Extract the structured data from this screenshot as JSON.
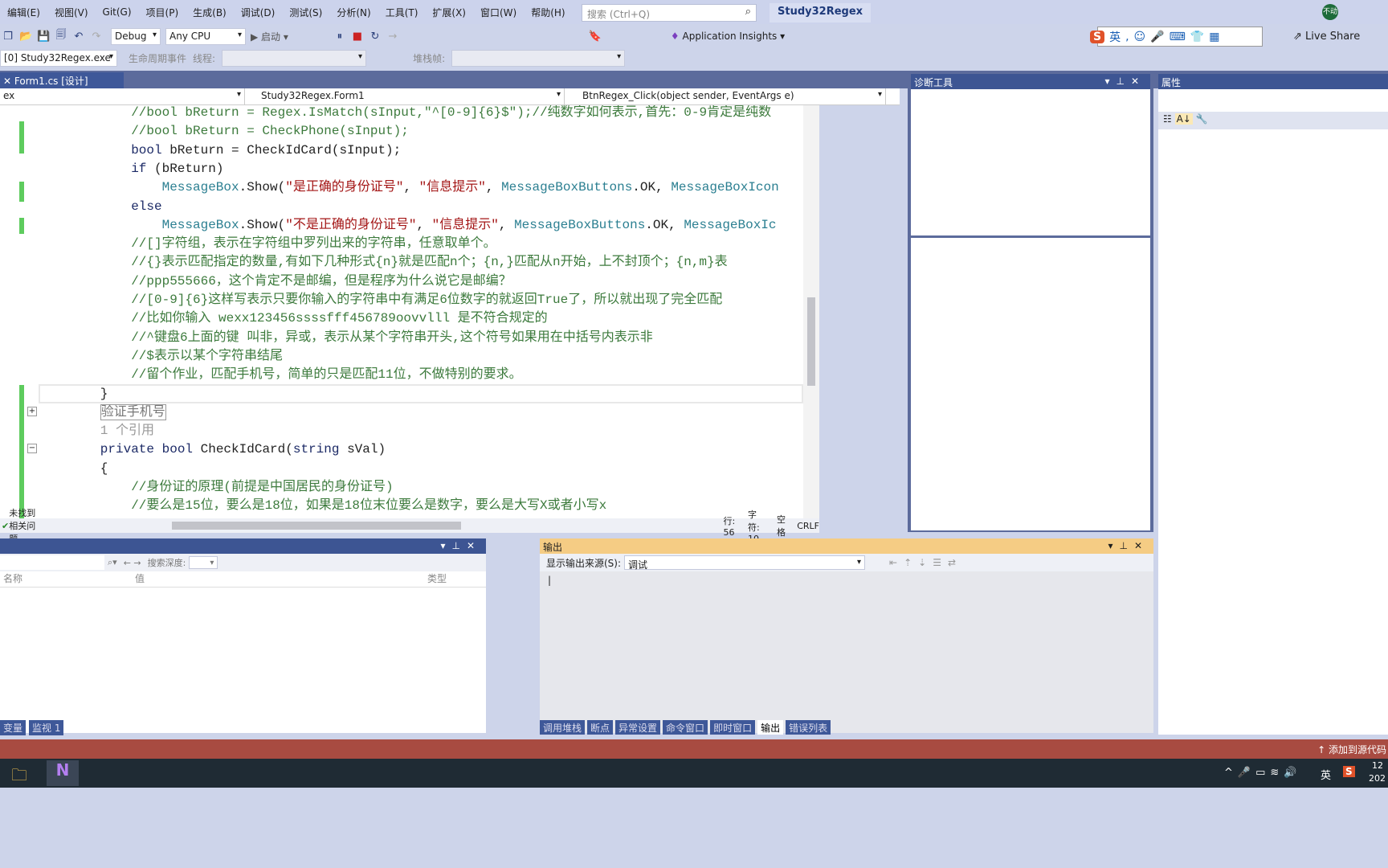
{
  "menu": [
    "编辑(E)",
    "视图(V)",
    "Git(G)",
    "项目(P)",
    "生成(B)",
    "调试(D)",
    "测试(S)",
    "分析(N)",
    "工具(T)",
    "扩展(X)",
    "窗口(W)",
    "帮助(H)"
  ],
  "search": {
    "placeholder": "搜索 (Ctrl+Q)"
  },
  "solution_name": "Study32Regex",
  "avatar_text": "不动",
  "toolbar": {
    "config": "Debug",
    "platform": "Any CPU",
    "start": "启动",
    "app_insights": "Application Insights",
    "live_share": "Live Share"
  },
  "ime": {
    "lang": "英"
  },
  "debug_bar": {
    "process": "[0] Study32Regex.exe",
    "lifecycle": "生命周期事件",
    "thread": "线程:",
    "stack": "堆栈帧:"
  },
  "editor_tab": "Form1.cs [设计]",
  "nav": {
    "project": "ex",
    "class": "Study32Regex.Form1",
    "member": "BtnRegex_Click(object sender, EventArgs e)"
  },
  "code": [
    {
      "i": 12,
      "t": [
        [
          "cm",
          "//bool bReturn = Regex.IsMatch(sInput,\"^[0-9]{6}$\");//纯数字如何表示,首先：0-9肯定是纯数"
        ]
      ]
    },
    {
      "i": 12,
      "t": [
        [
          "cm",
          "//bool bReturn = CheckPhone(sInput);"
        ]
      ]
    },
    {
      "i": 12,
      "t": [
        [
          "kw",
          "bool "
        ],
        [
          "pl",
          "bReturn = CheckIdCard(sInput);"
        ]
      ]
    },
    {
      "i": 12,
      "t": [
        [
          "kw",
          "if "
        ],
        [
          "pl",
          "(bReturn)"
        ]
      ]
    },
    {
      "i": 16,
      "t": [
        [
          "type",
          "MessageBox"
        ],
        [
          "pl",
          ".Show("
        ],
        [
          "str",
          "\"是正确的身份证号\""
        ],
        [
          "pl",
          ", "
        ],
        [
          "str",
          "\"信息提示\""
        ],
        [
          "pl",
          ", "
        ],
        [
          "type",
          "MessageBoxButtons"
        ],
        [
          "pl",
          ".OK, "
        ],
        [
          "type",
          "MessageBoxIcon"
        ]
      ]
    },
    {
      "i": 12,
      "t": [
        [
          "kw",
          "else"
        ]
      ]
    },
    {
      "i": 16,
      "t": [
        [
          "type",
          "MessageBox"
        ],
        [
          "pl",
          ".Show("
        ],
        [
          "str",
          "\"不是正确的身份证号\""
        ],
        [
          "pl",
          ", "
        ],
        [
          "str",
          "\"信息提示\""
        ],
        [
          "pl",
          ", "
        ],
        [
          "type",
          "MessageBoxButtons"
        ],
        [
          "pl",
          ".OK, "
        ],
        [
          "type",
          "MessageBoxIc"
        ]
      ]
    },
    {
      "i": 12,
      "t": [
        [
          "cm",
          "//[]字符组，表示在字符组中罗列出来的字符串，任意取单个。"
        ]
      ]
    },
    {
      "i": 12,
      "t": [
        [
          "cm",
          "//{}表示匹配指定的数量,有如下几种形式{n}就是匹配n个；{n,}匹配从n开始，上不封顶个；{n,m}表"
        ]
      ]
    },
    {
      "i": 12,
      "t": [
        [
          "cm",
          "//ppp555666，这个肯定不是邮编，但是程序为什么说它是邮编？"
        ]
      ]
    },
    {
      "i": 12,
      "t": [
        [
          "cm",
          "//[0-9]{6}这样写表示只要你输入的字符串中有满足6位数字的就返回True了，所以就出现了完全匹配"
        ]
      ]
    },
    {
      "i": 12,
      "t": [
        [
          "cm",
          "//比如你输入 wexx123456ssssfff456789oovvlll 是不符合规定的"
        ]
      ]
    },
    {
      "i": 12,
      "t": [
        [
          "cm",
          "//^键盘6上面的键 叫非，异或，表示从某个字符串开头,这个符号如果用在中括号内表示非"
        ]
      ]
    },
    {
      "i": 12,
      "t": [
        [
          "cm",
          "//$表示以某个字符串结尾"
        ]
      ]
    },
    {
      "i": 12,
      "t": [
        [
          "cm",
          "//留个作业，匹配手机号，简单的只是匹配11位，不做特别的要求。"
        ]
      ]
    },
    {
      "i": 8,
      "t": [
        [
          "pl",
          "}"
        ]
      ]
    },
    {
      "i": 8,
      "t": [
        [
          "box",
          "验证手机号"
        ]
      ]
    },
    {
      "i": 8,
      "t": [
        [
          "gray",
          "1 个引用"
        ]
      ]
    },
    {
      "i": 8,
      "t": [
        [
          "kw",
          "private bool "
        ],
        [
          "pl",
          "CheckIdCard("
        ],
        [
          "kw",
          "string "
        ],
        [
          "pl",
          "sVal)"
        ]
      ]
    },
    {
      "i": 8,
      "t": [
        [
          "pl",
          "{"
        ]
      ]
    },
    {
      "i": 12,
      "t": [
        [
          "cm",
          "//身份证的原理(前提是中国居民的身份证号)"
        ]
      ]
    },
    {
      "i": 12,
      "t": [
        [
          "cm",
          "//要么是15位，要么是18位，如果是18位末位要么是数字，要么是大写X或者小写x"
        ]
      ]
    }
  ],
  "editor_status": {
    "issues": "未找到相关问题",
    "line": "行: 56",
    "char": "字符: 10",
    "spacing": "空格",
    "eol": "CRLF"
  },
  "diag": {
    "title": "诊断工具"
  },
  "props": {
    "title": "属性"
  },
  "locals": {
    "search_depth": "搜索深度:",
    "columns": [
      "名称",
      "值",
      "类型"
    ],
    "tabs": [
      "变量",
      "监视 1"
    ]
  },
  "output": {
    "title": "输出",
    "source_label": "显示输出来源(S):",
    "source": "调试"
  },
  "bottom_tabs": [
    "调用堆栈",
    "断点",
    "异常设置",
    "命令窗口",
    "即时窗口",
    "输出",
    "错误列表"
  ],
  "active_bottom_tab": "输出",
  "statusbar": {
    "source_control": "添加到源代码"
  },
  "tray": {
    "ime": "英",
    "time": "12",
    "date": "202"
  },
  "colors": {
    "accent": "#3e5899",
    "status": "#a84b41",
    "output_header": "#f5cc84"
  }
}
